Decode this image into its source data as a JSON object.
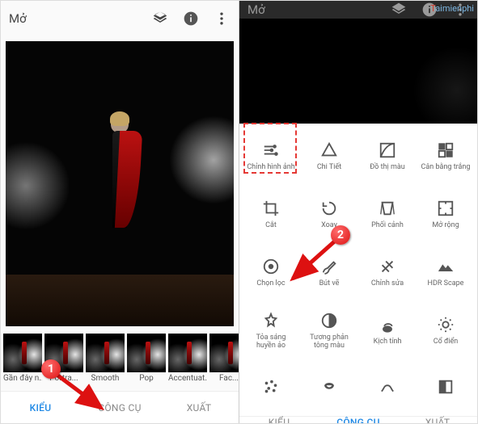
{
  "left": {
    "header": {
      "open_label": "Mở"
    },
    "filters": [
      {
        "label": "Gần đây n..."
      },
      {
        "label": "Portra..."
      },
      {
        "label": "Smooth"
      },
      {
        "label": "Pop"
      },
      {
        "label": "Accentuat..."
      },
      {
        "label": "Fac..."
      }
    ],
    "nav": {
      "kieu": "KIỂU",
      "congcu": "CÔNG CỤ",
      "xuat": "XUẤT",
      "active": "kieu"
    }
  },
  "right": {
    "header": {
      "open_label": "Mở"
    },
    "tools": [
      {
        "name": "tune",
        "label": "Chỉnh hình ảnh"
      },
      {
        "name": "details",
        "label": "Chi Tiết"
      },
      {
        "name": "curves",
        "label": "Đồ thị màu"
      },
      {
        "name": "whitebal",
        "label": "Cân bằng trắng"
      },
      {
        "name": "crop",
        "label": "Cắt"
      },
      {
        "name": "rotate",
        "label": "Xoay"
      },
      {
        "name": "perspective",
        "label": "Phối cảnh"
      },
      {
        "name": "expand",
        "label": "Mở rộng"
      },
      {
        "name": "selective",
        "label": "Chọn lọc"
      },
      {
        "name": "brush",
        "label": "Bút vẽ"
      },
      {
        "name": "healing",
        "label": "Chỉnh sửa"
      },
      {
        "name": "hdr",
        "label": "HDR Scape"
      },
      {
        "name": "glamour",
        "label": "Tỏa sáng huyền ảo"
      },
      {
        "name": "tonal",
        "label": "Tương phản tông màu"
      },
      {
        "name": "drama",
        "label": "Kịch tính"
      },
      {
        "name": "vintage",
        "label": "Cổ điển"
      },
      {
        "name": "grainy",
        "label": ""
      },
      {
        "name": "retrolux",
        "label": ""
      },
      {
        "name": "grunge",
        "label": ""
      },
      {
        "name": "bw",
        "label": ""
      }
    ],
    "nav": {
      "kieu": "KIỂU",
      "congcu": "CÔNG CỤ",
      "xuat": "XUẤT",
      "active": "congcu"
    }
  },
  "icons": {
    "stacks": "stacks-icon",
    "info": "info-icon",
    "more": "more-vert-icon"
  },
  "watermark": {
    "pre": "T",
    "rest": "aimienphi"
  },
  "steps": {
    "one": "1",
    "two": "2"
  }
}
